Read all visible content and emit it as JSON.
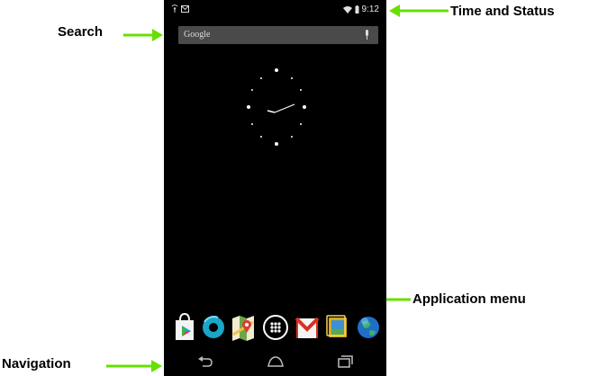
{
  "annotations": {
    "time_status": "Time and Status",
    "search": "Search",
    "application_menu": "Application menu",
    "navigation": "Navigation"
  },
  "status_bar": {
    "time": "9:12",
    "left_icons": [
      "signal-icon",
      "gmail-notification-icon"
    ],
    "right_icons": [
      "wifi-icon",
      "battery-icon"
    ]
  },
  "search_bar": {
    "placeholder": "Google",
    "mic_icon": "microphone-icon"
  },
  "clock": {
    "type": "analog",
    "icon": "analog-clock"
  },
  "dock_apps": [
    "play-store-icon",
    "ring-app-icon",
    "maps-icon",
    "app-drawer-icon",
    "gmail-icon",
    "gallery-icon",
    "browser-globe-icon"
  ],
  "nav_buttons": [
    "back-icon",
    "home-icon",
    "recent-apps-icon"
  ],
  "colors": {
    "arrow_green": "#66e000",
    "phone_bg": "#000000",
    "search_bg": "#4a4a4a"
  }
}
